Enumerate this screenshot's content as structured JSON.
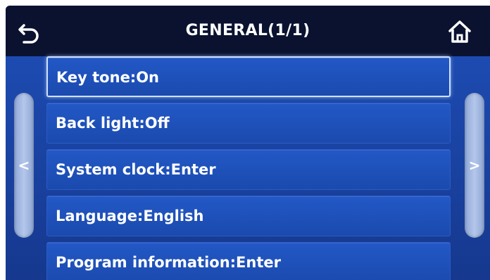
{
  "header": {
    "title": "GENERAL(1/1)",
    "back_icon": "back-arrow-icon",
    "home_icon": "home-icon"
  },
  "nav": {
    "prev_glyph": "<",
    "next_glyph": ">"
  },
  "menu": {
    "items": [
      {
        "label": "Key tone:On",
        "selected": true
      },
      {
        "label": "Back light:Off",
        "selected": false
      },
      {
        "label": "System clock:Enter",
        "selected": false
      },
      {
        "label": "Language:English",
        "selected": false
      },
      {
        "label": "Program information:Enter",
        "selected": false
      }
    ]
  },
  "colors": {
    "header_bg": "#0a1230",
    "panel_bg": "#1b46a8",
    "item_bg": "#2258c6",
    "text": "#ffffff",
    "selected_border": "#cfe0ff"
  }
}
